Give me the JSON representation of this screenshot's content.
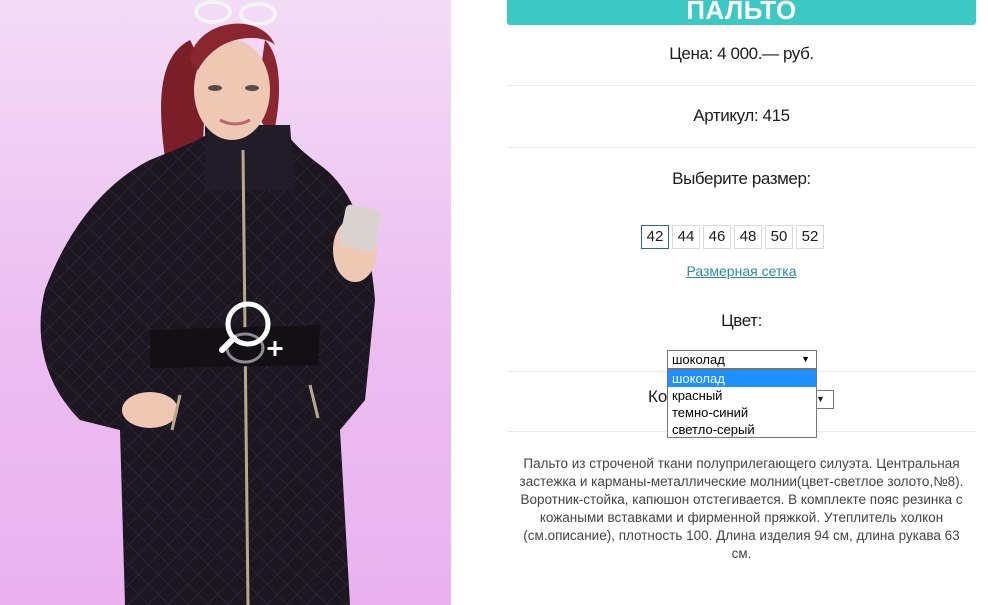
{
  "product": {
    "title": "ПАЛЬТО",
    "price": "Цена: 4 000.— руб.",
    "article": "Артикул: 415",
    "choose_size_label": "Выберите размер:",
    "sizes": [
      "42",
      "44",
      "46",
      "48",
      "50",
      "52"
    ],
    "selected_size": "42",
    "size_chart_link": "Размерная сетка",
    "color_label": "Цвет:",
    "color_select": {
      "value": "шоколад",
      "options": [
        "шоколад",
        "красный",
        "темно-синий",
        "светло-серый"
      ],
      "highlighted": "шоколад"
    },
    "quantity_label_partial": "Ко",
    "description": "Пальто из строченой ткани полуприлегающего силуэта. Центральная застежка и карманы-металлические молнии(цвет-светлое золото,№8). Воротник-стойка, капюшон отстегивается. В комплекте пояс резинка с кожаными вставками и фирменной пряжкой. Утеплитель холкон (см.описание), плотность 100. Длина изделия 94 см, длина рукава 63 см."
  },
  "icons": {
    "zoom": "zoom-in-magnifier-icon",
    "select_arrow": "triangle-down-icon"
  },
  "colors": {
    "title_bar": "#3cc9c3",
    "link": "#2a8c9c",
    "dropdown_highlight": "#1e90ff",
    "photo_background": "#ecbdf1"
  }
}
